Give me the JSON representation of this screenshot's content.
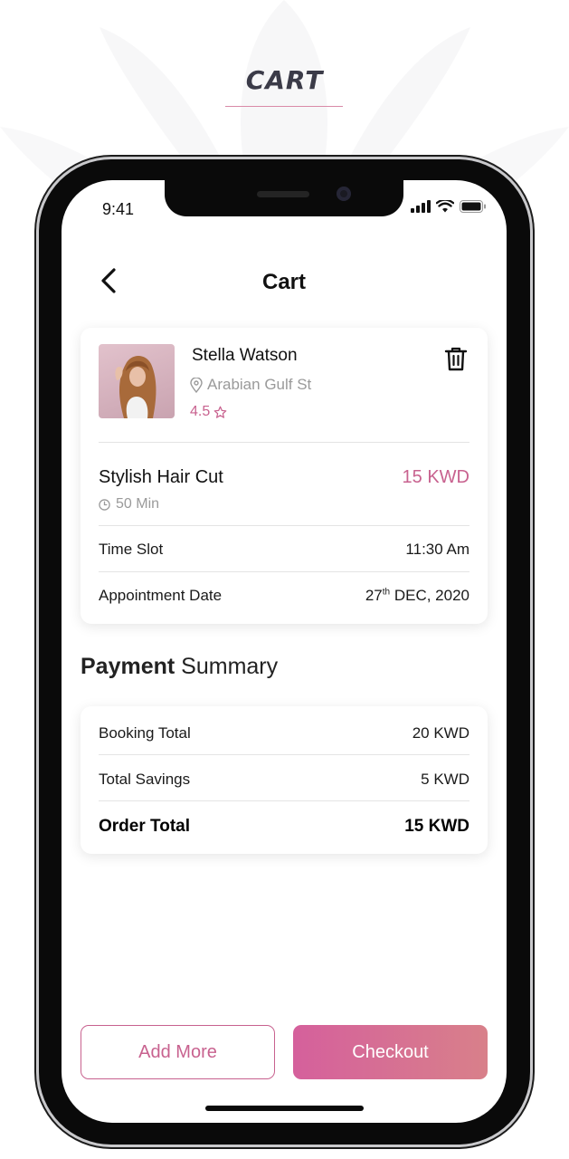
{
  "page": {
    "heading": "CART"
  },
  "status_bar": {
    "time": "9:41"
  },
  "nav": {
    "title": "Cart"
  },
  "stylist": {
    "name": "Stella Watson",
    "location": "Arabian Gulf St",
    "rating": "4.5"
  },
  "service": {
    "name": "Stylish Hair Cut",
    "price": "15 KWD",
    "duration": "50 Min"
  },
  "details": {
    "time_slot_label": "Time Slot",
    "time_slot_value": "11:30 Am",
    "date_label": "Appointment Date",
    "date_day": "27",
    "date_suffix": "th",
    "date_rest": " DEC, 2020"
  },
  "payment": {
    "title_bold": "Payment",
    "title_rest": " Summary",
    "rows": [
      {
        "label": "Booking Total",
        "value": "20 KWD"
      },
      {
        "label": "Total Savings",
        "value": "5 KWD"
      },
      {
        "label": "Order Total",
        "value": "15 KWD"
      }
    ]
  },
  "buttons": {
    "add_more": "Add More",
    "checkout": "Checkout"
  },
  "colors": {
    "accent": "#c8628f",
    "gradient_start": "#d5609c",
    "gradient_end": "#d8808a",
    "heading": "#3b3b48"
  },
  "icons": [
    "back-arrow-icon",
    "trash-icon",
    "location-pin-icon",
    "star-icon",
    "clock-icon",
    "signal-icon",
    "wifi-icon",
    "battery-icon"
  ]
}
